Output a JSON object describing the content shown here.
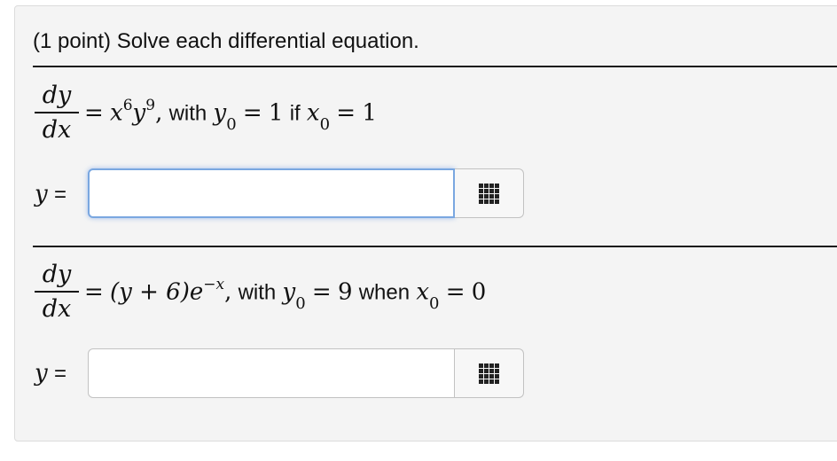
{
  "header": {
    "text": "(1 point) Solve each differential equation."
  },
  "problems": [
    {
      "frac_num": "dy",
      "frac_den": "dx",
      "rhs": {
        "eq": "=",
        "base1": "x",
        "exp1": "6",
        "base2": "y",
        "exp2": "9",
        "comma": ",",
        "text1": "with",
        "var_y": "y",
        "sub_y": "0",
        "eq2": "=",
        "val_y": "1",
        "text2": "if",
        "var_x": "x",
        "sub_x": "0",
        "eq3": "=",
        "val_x": "1"
      },
      "answer_label_var": "y",
      "answer_label_eq": "=",
      "answer_value": "",
      "focused": true
    },
    {
      "frac_num": "dy",
      "frac_den": "dx",
      "rhs": {
        "eq": "=",
        "expr": "(y + 6)e",
        "exp": "−x",
        "comma": ",",
        "text1": "with",
        "var_y": "y",
        "sub_y": "0",
        "eq2": "=",
        "val_y": "9",
        "text2": "when",
        "var_x": "x",
        "sub_x": "0",
        "eq3": "=",
        "val_x": "0"
      },
      "answer_label_var": "y",
      "answer_label_eq": "=",
      "answer_value": "",
      "focused": false
    }
  ],
  "icons": {
    "keypad": "keypad-grid-icon"
  },
  "colors": {
    "panel_bg": "#f4f4f4",
    "focus_ring": "#7aa7e0"
  }
}
